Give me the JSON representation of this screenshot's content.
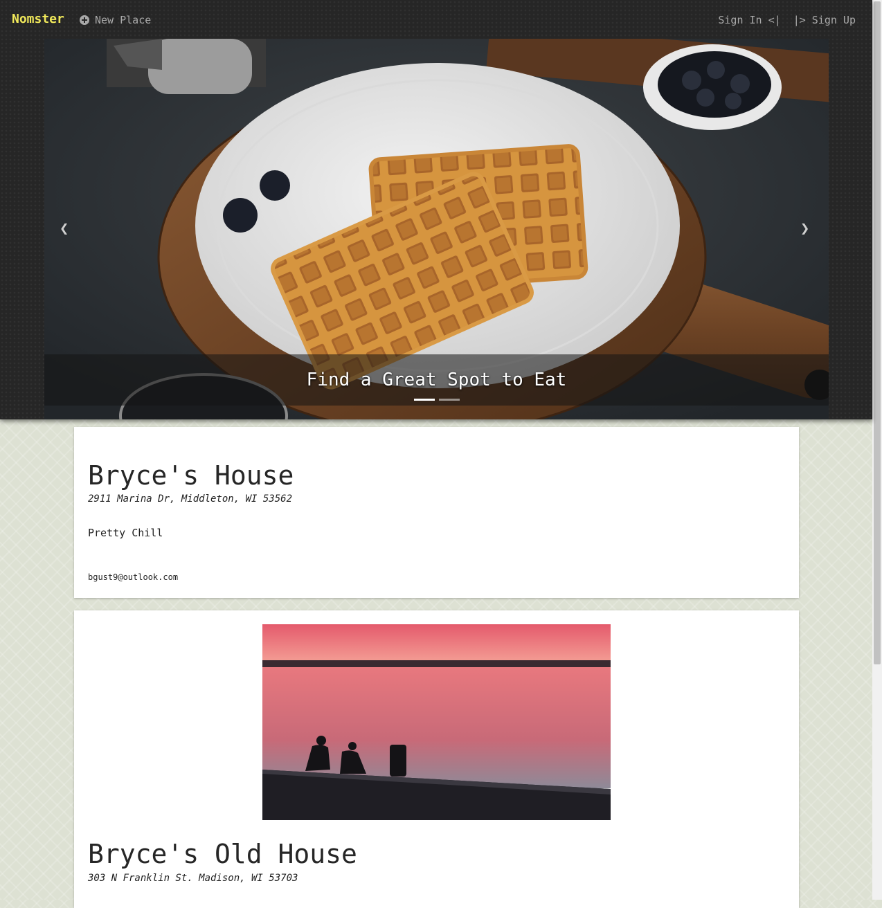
{
  "nav": {
    "brand": "Nomster",
    "new_place": "New Place",
    "sign_in": "Sign In <|",
    "sign_up": "|> Sign Up"
  },
  "carousel": {
    "caption": "Find a Great Spot to Eat",
    "slide_count": 2,
    "active_index": 0,
    "prev_icon": "chevron-left-icon",
    "next_icon": "chevron-right-icon"
  },
  "places": [
    {
      "name": "Bryce's House",
      "address": "2911 Marina Dr, Middleton, WI 53562",
      "description": "Pretty Chill",
      "email": "bgust9@outlook.com"
    },
    {
      "name": "Bryce's Old House",
      "address": "303 N Franklin St. Madison, WI 53703"
    }
  ],
  "colors": {
    "brand": "#f0e85a",
    "nav_text": "#a9a9a9",
    "header_bg": "#262626",
    "page_bg": "#dde1d3"
  }
}
